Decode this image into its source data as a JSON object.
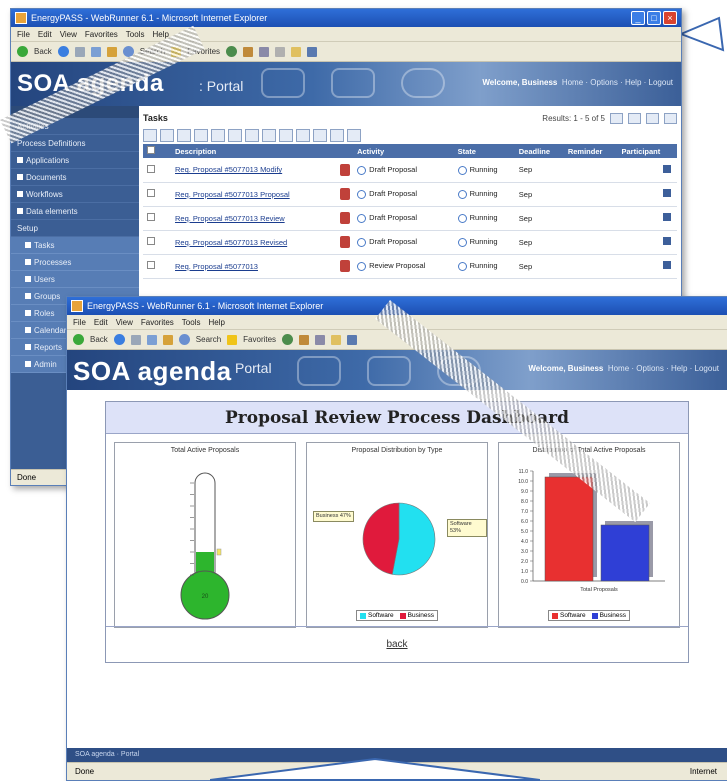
{
  "back_window": {
    "title": "EnergyPASS - WebRunner 6.1 - Microsoft Internet Explorer",
    "menu": [
      "File",
      "Edit",
      "View",
      "Favorites",
      "Tools",
      "Help"
    ],
    "toolbar": [
      "Back",
      "Search",
      "Favorites"
    ],
    "brand": "SOA agenda",
    "portal": ": Portal",
    "links_bold": "Welcome, Business",
    "links": "Home · Options · Help · Logout",
    "sidebar": [
      {
        "label": "Activities"
      },
      {
        "label": "Process Definitions"
      },
      {
        "label": "Applications"
      },
      {
        "label": "Documents"
      },
      {
        "label": "Workflows"
      },
      {
        "label": "Data elements"
      },
      {
        "label": "Setup"
      }
    ],
    "sidebar_subs": [
      "Tasks",
      "Processes",
      "Users",
      "Groups",
      "Roles",
      "Calendars",
      "Reports",
      "Admin"
    ],
    "list_title": "Tasks",
    "list_count": "Results: 1 - 5 of 5",
    "columns": [
      "",
      "",
      "Description",
      "",
      "Activity",
      "State",
      "Deadline",
      "Reminder",
      "Participant"
    ],
    "rows": [
      {
        "desc": "Req. Proposal #5077013 Modify",
        "activity": "Draft Proposal",
        "state": "Running",
        "deadline": "Sep"
      },
      {
        "desc": "Req. Proposal #5077013 Proposal",
        "activity": "Draft Proposal",
        "state": "Running",
        "deadline": "Sep"
      },
      {
        "desc": "Req. Proposal #5077013 Review",
        "activity": "Draft Proposal",
        "state": "Running",
        "deadline": "Sep"
      },
      {
        "desc": "Req. Proposal #5077013 Revised",
        "activity": "Draft Proposal",
        "state": "Running",
        "deadline": "Sep"
      },
      {
        "desc": "Req. Proposal #5077013",
        "activity": "Review Proposal",
        "state": "Running",
        "deadline": "Sep"
      }
    ],
    "status": "Done"
  },
  "front_window": {
    "title": "EnergyPASS - WebRunner 6.1 - Microsoft Internet Explorer",
    "menu": [
      "File",
      "Edit",
      "View",
      "Favorites",
      "Tools",
      "Help"
    ],
    "toolbar": [
      "Back",
      "Search",
      "Favorites"
    ],
    "brand": "SOA agenda",
    "portal": "Portal",
    "links_bold": "Welcome, Business",
    "links": "Home · Options · Help · Logout",
    "dashboard_title": "Proposal Review Process Dashboard",
    "foot_link": "back",
    "bottom_bar": "SOA agenda · Portal",
    "status": "Done",
    "status_right": "Internet"
  },
  "chart_data": [
    {
      "type": "thermometer",
      "title": "Total Active Proposals",
      "value": 20,
      "ylim": [
        0,
        80
      ],
      "colors": {
        "fill": "#2db52d"
      }
    },
    {
      "type": "pie",
      "title": "Proposal Distribution by Type",
      "categories": [
        "Software",
        "Business"
      ],
      "values": [
        53,
        47
      ],
      "labels": [
        "Software 53%",
        "Business 47%"
      ],
      "colors": {
        "Software": "#22e0f0",
        "Business": "#e01a3c"
      }
    },
    {
      "type": "bar",
      "title": "Distribution of Total Active Proposals",
      "categories": [
        "Total Proposals"
      ],
      "series": [
        {
          "name": "Software",
          "values": [
            10.4
          ]
        },
        {
          "name": "Business",
          "values": [
            5.6
          ]
        }
      ],
      "xlabel": "Total Proposals",
      "ylim": [
        0,
        11
      ],
      "colors": {
        "Software": "#e83030",
        "Business": "#2f3fd6"
      }
    }
  ],
  "colors": {
    "banner": "#24457e",
    "sidebar": "#3b5e94",
    "table_header": "#4b6ea8"
  }
}
